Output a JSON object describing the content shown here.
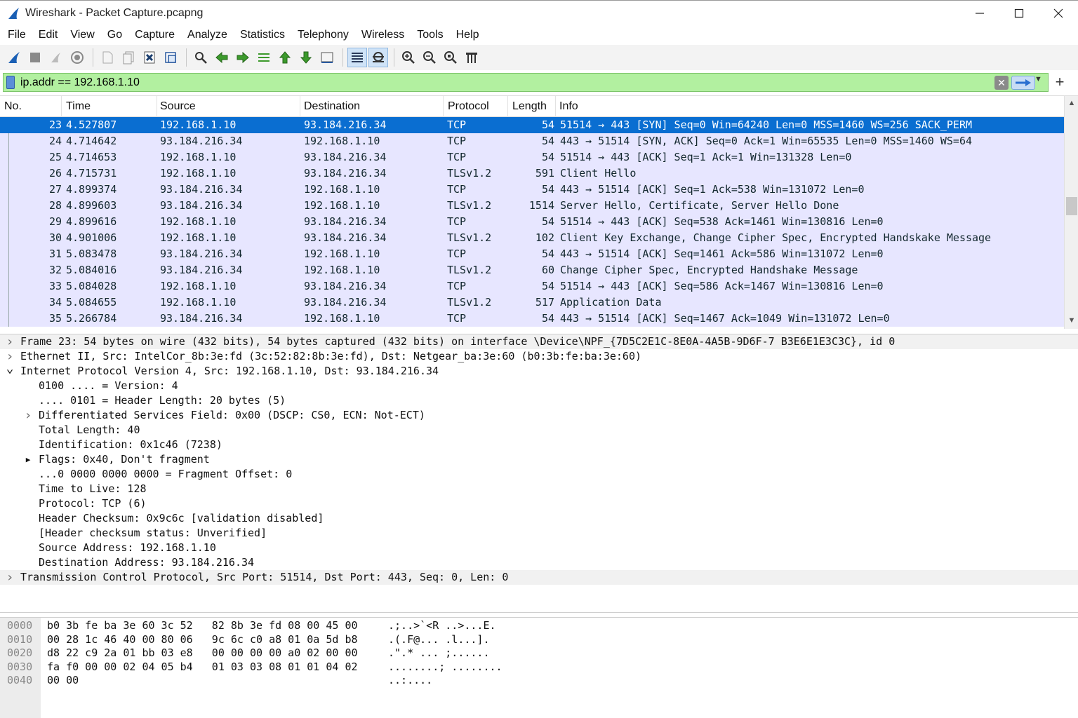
{
  "window": {
    "title": "Wireshark - Packet Capture.pcapng",
    "minimize": "—",
    "maximize": "☐",
    "close": "✕"
  },
  "menu": [
    "File",
    "Edit",
    "View",
    "Go",
    "Capture",
    "Analyze",
    "Statistics",
    "Telephony",
    "Wireless",
    "Tools",
    "Help"
  ],
  "toolbar": {
    "icons": [
      "start-capture-icon",
      "stop-capture-icon",
      "restart-capture-icon",
      "capture-options-icon",
      "open-file-icon",
      "save-file-icon",
      "close-file-icon",
      "reload-file-icon",
      "find-packet-icon",
      "go-back-icon",
      "go-forward-icon",
      "go-to-packet-icon",
      "go-first-icon",
      "go-last-icon",
      "auto-scroll-icon",
      "colorize-icon",
      "auto-resize-icon",
      "zoom-in-icon",
      "zoom-out-icon",
      "zoom-normal-icon",
      "resize-columns-icon"
    ]
  },
  "filter": {
    "value": "ip.addr == 192.168.1.10",
    "color": "#b2f0a0",
    "add_label": "+"
  },
  "packet_list": {
    "columns": [
      "No.",
      "Time",
      "Source",
      "Destination",
      "Protocol",
      "Length",
      "Info"
    ],
    "selected_index": 0,
    "row_color": "#e7e6ff",
    "selected_color": "#0a6ed1",
    "rows": [
      {
        "no": "23",
        "time": "4.527807",
        "src": "192.168.1.10",
        "dst": "93.184.216.34",
        "proto": "TCP",
        "len": "54",
        "info": "51514 → 443 [SYN] Seq=0 Win=64240 Len=0 MSS=1460 WS=256 SACK_PERM"
      },
      {
        "no": "24",
        "time": "4.714642",
        "src": "93.184.216.34",
        "dst": "192.168.1.10",
        "proto": "TCP",
        "len": "54",
        "info": "443 → 51514 [SYN, ACK] Seq=0 Ack=1 Win=65535 Len=0 MSS=1460 WS=64"
      },
      {
        "no": "25",
        "time": "4.714653",
        "src": "192.168.1.10",
        "dst": "93.184.216.34",
        "proto": "TCP",
        "len": "54",
        "info": "51514 → 443 [ACK] Seq=1 Ack=1 Win=131328 Len=0"
      },
      {
        "no": "26",
        "time": "4.715731",
        "src": "192.168.1.10",
        "dst": "93.184.216.34",
        "proto": "TLSv1.2",
        "len": "591",
        "info": "Client Hello"
      },
      {
        "no": "27",
        "time": "4.899374",
        "src": "93.184.216.34",
        "dst": "192.168.1.10",
        "proto": "TCP",
        "len": "54",
        "info": "443 → 51514 [ACK] Seq=1 Ack=538 Win=131072 Len=0"
      },
      {
        "no": "28",
        "time": "4.899603",
        "src": "93.184.216.34",
        "dst": "192.168.1.10",
        "proto": "TLSv1.2",
        "len": "1514",
        "info": "Server Hello, Certificate, Server Hello Done"
      },
      {
        "no": "29",
        "time": "4.899616",
        "src": "192.168.1.10",
        "dst": "93.184.216.34",
        "proto": "TCP",
        "len": "54",
        "info": "51514 → 443 [ACK] Seq=538 Ack=1461 Win=130816 Len=0"
      },
      {
        "no": "30",
        "time": "4.901006",
        "src": "192.168.1.10",
        "dst": "93.184.216.34",
        "proto": "TLSv1.2",
        "len": "102",
        "info": "Client Key Exchange, Change Cipher Spec, Encrypted Handskake Message"
      },
      {
        "no": "31",
        "time": "5.083478",
        "src": "93.184.216.34",
        "dst": "192.168.1.10",
        "proto": "TCP",
        "len": "54",
        "info": "443 → 51514 [ACK] Seq=1461 Ack=586 Win=131072 Len=0"
      },
      {
        "no": "32",
        "time": "5.084016",
        "src": "93.184.216.34",
        "dst": "192.168.1.10",
        "proto": "TLSv1.2",
        "len": "60",
        "info": "Change Cipher Spec, Encrypted Handshake Message"
      },
      {
        "no": "33",
        "time": "5.084028",
        "src": "192.168.1.10",
        "dst": "93.184.216.34",
        "proto": "TCP",
        "len": "54",
        "info": "51514 → 443 [ACK] Seq=586 Ack=1467 Win=130816 Len=0"
      },
      {
        "no": "34",
        "time": "5.084655",
        "src": "192.168.1.10",
        "dst": "93.184.216.34",
        "proto": "TLSv1.2",
        "len": "517",
        "info": "Application Data"
      },
      {
        "no": "35",
        "time": "5.266784",
        "src": "93.184.216.34",
        "dst": "192.168.1.10",
        "proto": "TCP",
        "len": "54",
        "info": "443 → 51514 [ACK] Seq=1467 Ack=1049 Win=131072 Len=0"
      }
    ]
  },
  "details": [
    {
      "level": 0,
      "arrow": ">",
      "alt": true,
      "text": "Frame 23: 54 bytes on wire (432 bits), 54 bytes captured (432 bits) on interface \\Device\\NPF_{7D5C2E1C-8E0A-4A5B-9D6F-7 B3E6E1E3C3C}, id 0"
    },
    {
      "level": 0,
      "arrow": ">",
      "alt": false,
      "text": "Ethernet II, Src: IntelCor_8b:3e:fd (3c:52:82:8b:3e:fd), Dst: Netgear_ba:3e:60 (b0:3b:fe:ba:3e:60)"
    },
    {
      "level": 0,
      "arrow": "v",
      "alt": false,
      "text": "Internet Protocol Version 4, Src: 192.168.1.10, Dst: 93.184.216.34"
    },
    {
      "level": 1,
      "arrow": "",
      "alt": false,
      "text": "0100 .... = Version: 4"
    },
    {
      "level": 1,
      "arrow": "",
      "alt": false,
      "text": ".... 0101 = Header Length: 20 bytes (5)"
    },
    {
      "level": 1,
      "arrow": ">",
      "alt": false,
      "text": "Differentiated Services Field: 0x00 (DSCP: CS0, ECN: Not-ECT)"
    },
    {
      "level": 1,
      "arrow": "",
      "alt": false,
      "text": "Total Length: 40"
    },
    {
      "level": 1,
      "arrow": "",
      "alt": false,
      "text": "Identification: 0x1c46 (7238)"
    },
    {
      "level": 1,
      "arrow": "▶",
      "alt": false,
      "text": "Flags: 0x40, Don't fragment"
    },
    {
      "level": 1,
      "arrow": "",
      "alt": false,
      "text": "...0 0000 0000 0000 = Fragment Offset: 0"
    },
    {
      "level": 1,
      "arrow": "",
      "alt": false,
      "text": "Time to Live: 128"
    },
    {
      "level": 1,
      "arrow": "",
      "alt": false,
      "text": "Protocol: TCP (6)"
    },
    {
      "level": 1,
      "arrow": "",
      "alt": false,
      "text": "Header Checksum: 0x9c6c [validation disabled]"
    },
    {
      "level": 1,
      "arrow": "",
      "alt": false,
      "text": "[Header checksum status: Unverified]"
    },
    {
      "level": 1,
      "arrow": "",
      "alt": false,
      "text": "Source Address: 192.168.1.10"
    },
    {
      "level": 1,
      "arrow": "",
      "alt": false,
      "text": "Destination Address: 93.184.216.34"
    },
    {
      "level": 0,
      "arrow": ">",
      "alt": true,
      "text": "Transmission Control Protocol, Src Port: 51514, Dst Port: 443, Seq: 0, Len: 0"
    }
  ],
  "bytes": [
    {
      "offset": "0000",
      "hex": "b0 3b fe ba 3e 60 3c 52   82 8b 3e fd 08 00 45 00",
      "ascii": ".;..>`<R ..>...E."
    },
    {
      "offset": "0010",
      "hex": "00 28 1c 46 40 00 80 06   9c 6c c0 a8 01 0a 5d b8",
      "ascii": ".(.F@... .l...]."
    },
    {
      "offset": "0020",
      "hex": "d8 22 c9 2a 01 bb 03 e8   00 00 00 00 a0 02 00 00",
      "ascii": ".\".* ... ;......"
    },
    {
      "offset": "0030",
      "hex": "fa f0 00 00 02 04 05 b4   01 03 03 08 01 01 04 02",
      "ascii": "........; ........"
    },
    {
      "offset": "0040",
      "hex": "00 00",
      "ascii": "..:...."
    }
  ]
}
